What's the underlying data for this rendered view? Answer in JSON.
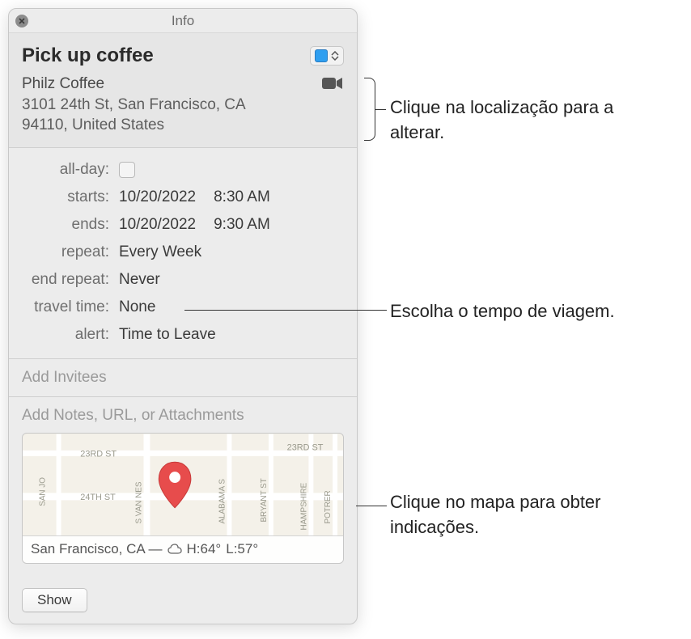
{
  "window": {
    "title": "Info"
  },
  "event": {
    "title": "Pick up coffee",
    "calendar_color": "#2f9ff0",
    "location": {
      "name": "Philz Coffee",
      "line2": "3101 24th St, San Francisco, CA",
      "line3": "94110, United States"
    }
  },
  "details": {
    "labels": {
      "all_day": "all-day:",
      "starts": "starts:",
      "ends": "ends:",
      "repeat": "repeat:",
      "end_repeat": "end repeat:",
      "travel_time": "travel time:",
      "alert": "alert:"
    },
    "starts_date": "10/20/2022",
    "starts_time": "8:30 AM",
    "ends_date": "10/20/2022",
    "ends_time": "9:30 AM",
    "repeat": "Every Week",
    "end_repeat": "Never",
    "travel_time": "None",
    "alert": "Time to Leave"
  },
  "placeholders": {
    "invitees": "Add Invitees",
    "notes": "Add Notes, URL, or Attachments"
  },
  "map": {
    "streets": {
      "s1": "23RD ST",
      "s2": "24TH ST",
      "s3": "SAN JO",
      "s4": "S VAN NES",
      "s5": "ALABAMA S",
      "s6": "BRYANT ST",
      "s7": "POTRER",
      "s8": "HAMPSHIRE",
      "s9": "23RD ST"
    },
    "weather": {
      "city": "San Francisco, CA —",
      "hi": "H:64°",
      "lo": "L:57°"
    }
  },
  "footer": {
    "show": "Show"
  },
  "callouts": {
    "location": "Clique na localização para a alterar.",
    "travel": "Escolha o tempo de viagem.",
    "map": "Clique no mapa para obter indicações."
  }
}
